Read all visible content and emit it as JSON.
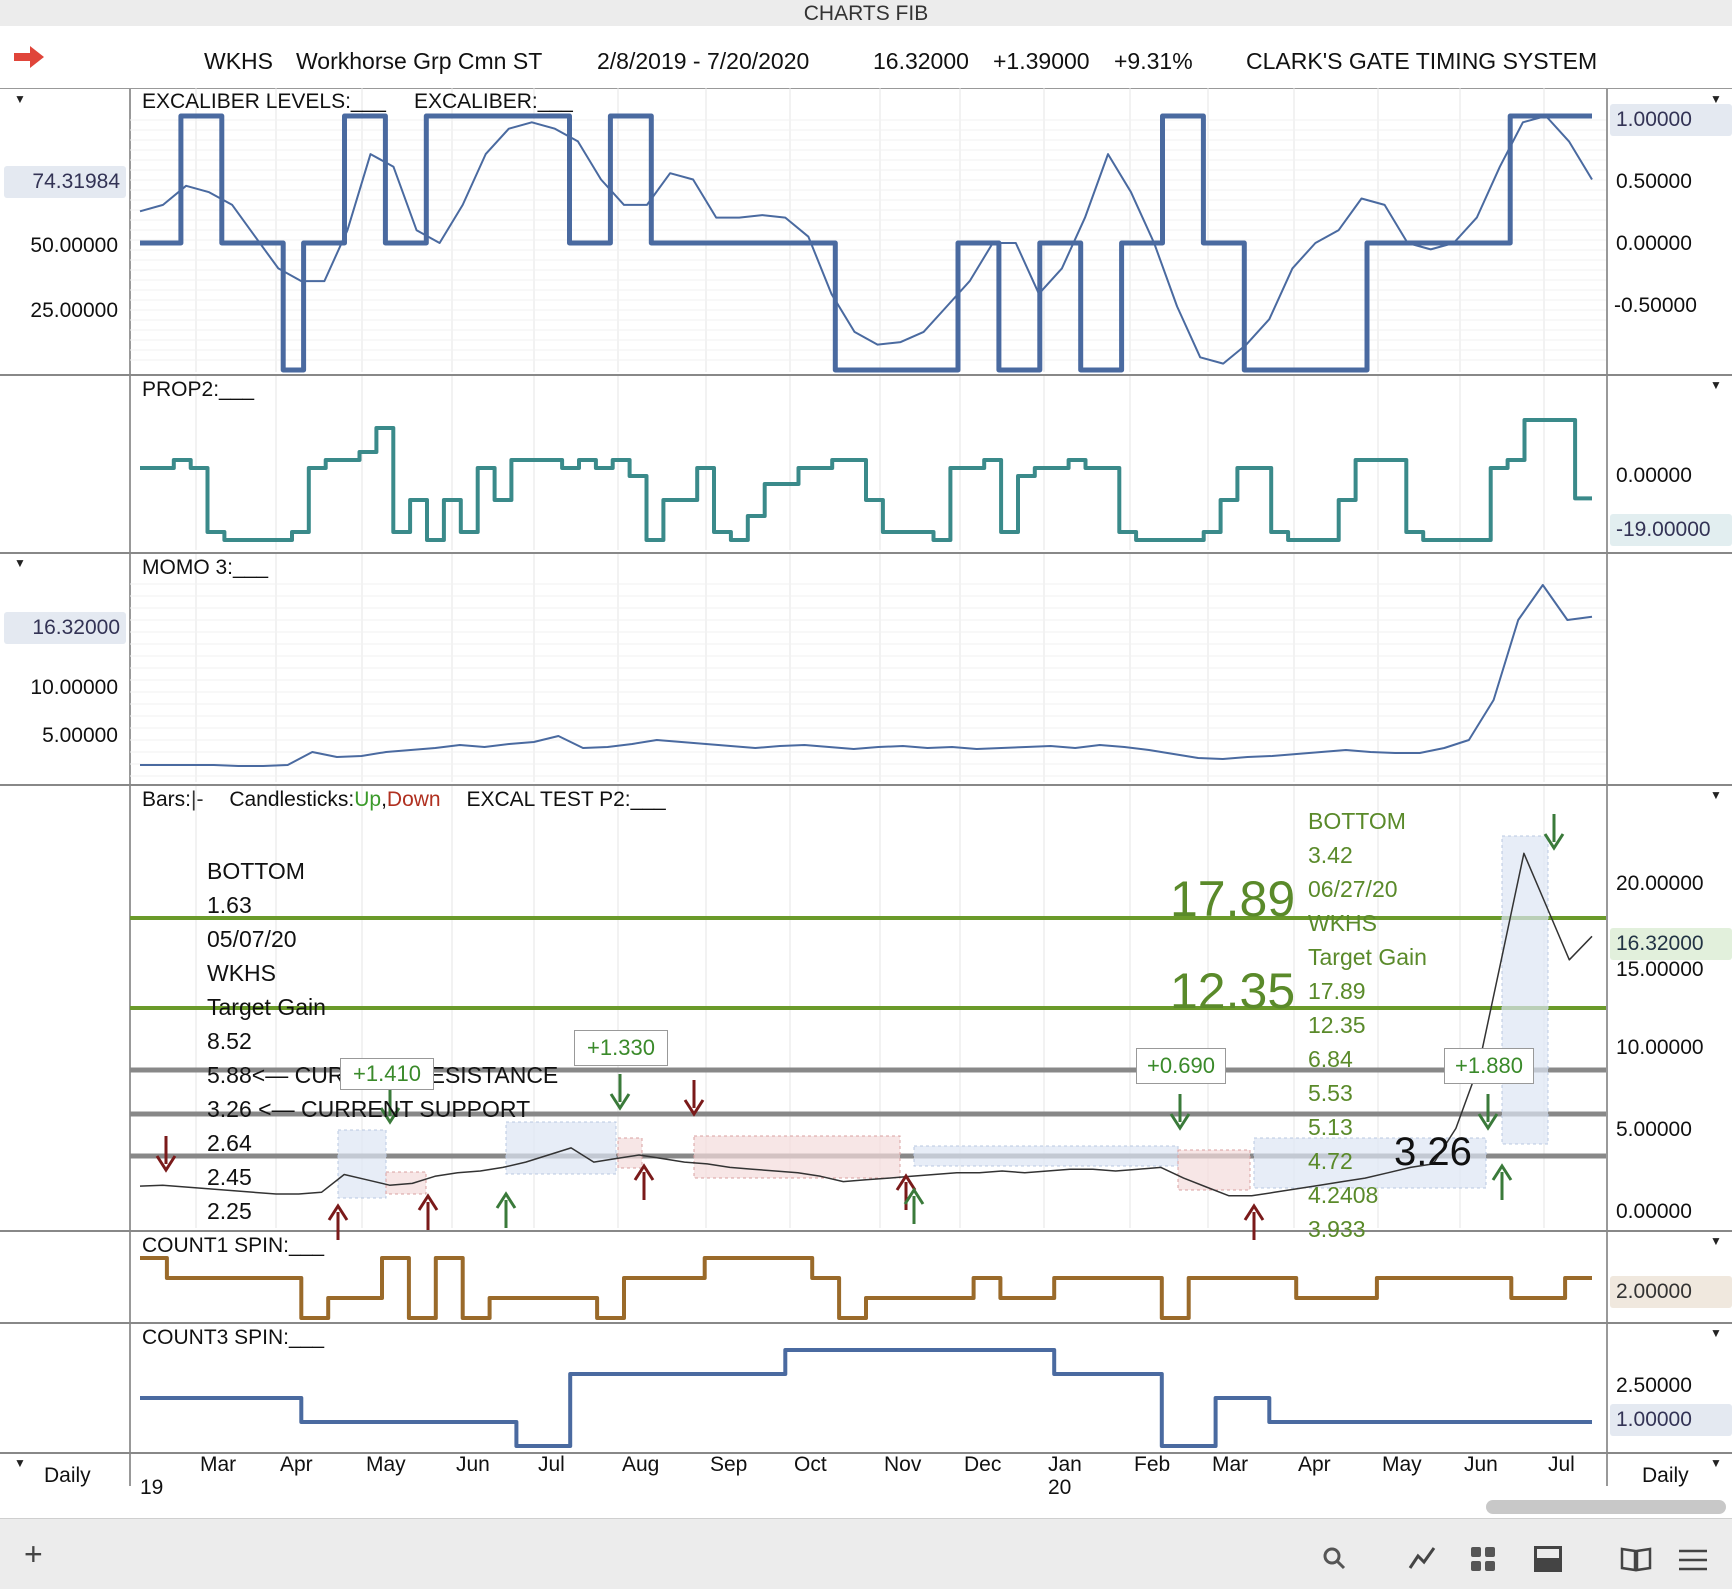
{
  "window_title": "CHARTS FIB",
  "header": {
    "symbol": "WKHS",
    "name": "Workhorse Grp Cmn ST",
    "date_range": "2/8/2019 - 7/20/2020",
    "last": "16.32000",
    "change": "+1.39000",
    "change_pct": "+9.31%",
    "system": "CLARK'S GATE TIMING SYSTEM"
  },
  "panels": {
    "excaliber": {
      "label1": "EXCALIBER LEVELS:___",
      "label2": "EXCALIBER:___",
      "left_axis": [
        "50.00000",
        "25.00000"
      ],
      "left_tag": "74.31984",
      "right_axis": [
        "0.50000",
        "0.00000",
        "-0.50000"
      ],
      "right_tag": "1.00000"
    },
    "prop2": {
      "label": "PROP2:___",
      "right_axis": [
        "0.00000"
      ],
      "right_tag": "-19.00000"
    },
    "momo3": {
      "label": "MOMO 3:___",
      "left_axis": [
        "10.00000",
        "5.00000"
      ],
      "left_tag": "16.32000"
    },
    "price": {
      "label_bars": "Bars:",
      "label_bars_sym": "|-",
      "label_candles": "Candlesticks:",
      "label_up": "Up",
      "label_comma": ",",
      "label_down": "Down",
      "label_excal": "EXCAL TEST P2:___",
      "right_axis": [
        "20.00000",
        "10.00000",
        "5.00000",
        "0.00000"
      ],
      "right_tag": "16.32000",
      "right_partial": "15.00000",
      "left_annotation": [
        "BOTTOM",
        "1.63",
        "05/07/20",
        "WKHS",
        "Target Gain",
        "8.52",
        "5.88<—  CURRENT RESISTANCE",
        "3.26 <— CURRENT SUPPORT",
        "2.64",
        "2.45",
        "2.25"
      ],
      "right_annotation": [
        "BOTTOM",
        "3.42",
        "06/27/20",
        "WKHS",
        "Target Gain",
        "17.89",
        "12.35",
        "6.84",
        "5.53",
        "5.13",
        "4.72",
        "4.2408",
        "3.933"
      ],
      "big_labels": [
        "17.89",
        "12.35",
        "3.26"
      ],
      "box_labels": [
        "+1.330",
        "+0.690",
        "+1.880",
        "+1.410"
      ],
      "level_colors": {
        "green": "#6a9a2a",
        "gray": "#888888"
      }
    },
    "count1": {
      "label": "COUNT1 SPIN:___",
      "right_tag": "2.00000"
    },
    "count3": {
      "label": "COUNT3 SPIN:___",
      "right_axis": [
        "2.50000"
      ],
      "right_tag": "1.00000"
    }
  },
  "x_axis": {
    "months": [
      "Mar",
      "Apr",
      "May",
      "Jun",
      "Jul",
      "Aug",
      "Sep",
      "Oct",
      "Nov",
      "Dec",
      "Jan",
      "Feb",
      "Mar",
      "Apr",
      "May",
      "Jun",
      "Jul"
    ],
    "years": [
      "19",
      "20"
    ],
    "left_period": "Daily",
    "right_period": "Daily"
  },
  "chart_data": [
    {
      "type": "line",
      "title": "EXCALIBER LEVELS / EXCALIBER",
      "series": [
        {
          "name": "EXCALIBER LEVELS",
          "color": "#4a6aa0",
          "values": [
            0,
            0,
            1,
            1,
            0,
            0,
            0,
            -1,
            0,
            0,
            1,
            1,
            0,
            0,
            1,
            1,
            1,
            1,
            1,
            1,
            1,
            0,
            0,
            1,
            1,
            0,
            0,
            0,
            0,
            0,
            0,
            0,
            0,
            0,
            -1,
            -1,
            -1,
            -1,
            -1,
            -1,
            0,
            0,
            -1,
            -1,
            0,
            0,
            -1,
            -1,
            0,
            0,
            1,
            1,
            0,
            0,
            -1,
            -1,
            -1,
            -1,
            -1,
            -1,
            0,
            0,
            0,
            0,
            0,
            0,
            0,
            1,
            1,
            1,
            1,
            1
          ]
        },
        {
          "name": "EXCALIBER",
          "color": "#4a6aa0",
          "values": [
            0.25,
            0.3,
            0.45,
            0.4,
            0.3,
            0.05,
            -0.2,
            -0.3,
            -0.3,
            0.1,
            0.7,
            0.6,
            0.1,
            0.0,
            0.3,
            0.7,
            0.9,
            0.95,
            0.9,
            0.8,
            0.5,
            0.3,
            0.3,
            0.55,
            0.5,
            0.2,
            0.2,
            0.22,
            0.2,
            0.05,
            -0.4,
            -0.7,
            -0.8,
            -0.78,
            -0.7,
            -0.5,
            -0.3,
            0.0,
            0.0,
            -0.4,
            -0.2,
            0.2,
            0.7,
            0.4,
            0.0,
            -0.5,
            -0.9,
            -0.95,
            -0.8,
            -0.6,
            -0.2,
            0.0,
            0.1,
            0.35,
            0.3,
            0.0,
            -0.05,
            0.0,
            0.2,
            0.6,
            0.95,
            1.0,
            0.8,
            0.5
          ]
        }
      ],
      "ylim": [
        -1,
        1
      ]
    },
    {
      "type": "line",
      "title": "PROP2",
      "series": [
        {
          "name": "PROP2",
          "color": "#3a8a8a",
          "values": [
            0,
            0,
            5,
            0,
            -40,
            -45,
            -45,
            -45,
            -45,
            -40,
            0,
            5,
            5,
            10,
            25,
            -40,
            -20,
            -45,
            -20,
            -40,
            0,
            -20,
            5,
            5,
            5,
            0,
            5,
            0,
            5,
            -5,
            -45,
            -20,
            -20,
            0,
            -40,
            -45,
            -30,
            -10,
            -10,
            0,
            0,
            5,
            5,
            -20,
            -40,
            -40,
            -40,
            -45,
            0,
            0,
            5,
            -40,
            -5,
            0,
            0,
            5,
            0,
            0,
            -40,
            -45,
            -45,
            -45,
            -45,
            -40,
            -20,
            0,
            0,
            -40,
            -45,
            -45,
            -45,
            -20,
            5,
            5,
            5,
            -40,
            -45,
            -45,
            -45,
            -45,
            0,
            5,
            30,
            30,
            30,
            -19,
            -19
          ]
        }
      ],
      "ylim": [
        -50,
        40
      ]
    },
    {
      "type": "line",
      "title": "MOMO 3",
      "series": [
        {
          "name": "MOMO 3",
          "color": "#4a6aa0",
          "values": [
            1.5,
            1.5,
            1.5,
            1.5,
            1.4,
            1.4,
            1.5,
            2.8,
            2.3,
            2.4,
            2.8,
            3.0,
            3.2,
            3.5,
            3.3,
            3.6,
            3.8,
            4.4,
            3.2,
            3.3,
            3.6,
            4.0,
            3.8,
            3.6,
            3.4,
            3.2,
            3.4,
            3.5,
            3.3,
            3.1,
            3.3,
            3.4,
            3.2,
            3.3,
            3.1,
            3.2,
            3.3,
            3.4,
            3.2,
            3.5,
            3.3,
            3.0,
            2.6,
            2.2,
            2.1,
            2.3,
            2.4,
            2.6,
            2.8,
            3.0,
            2.8,
            2.7,
            2.7,
            3.2,
            4.0,
            8.0,
            16.0,
            19.5,
            16.0,
            16.32
          ]
        }
      ],
      "ylim": [
        0,
        20
      ]
    },
    {
      "type": "line",
      "title": "Bars / Candlesticks",
      "series": [
        {
          "name": "Price",
          "color": "#333333",
          "values": [
            2.25,
            2.3,
            2.2,
            2.1,
            2.0,
            1.9,
            1.8,
            1.8,
            1.9,
            2.9,
            2.6,
            2.3,
            2.4,
            2.8,
            3.0,
            3.1,
            3.3,
            3.6,
            4.0,
            4.4,
            3.6,
            3.8,
            4.0,
            3.8,
            3.6,
            3.5,
            3.3,
            3.2,
            3.1,
            3.0,
            2.8,
            2.5,
            2.6,
            2.7,
            2.8,
            2.9,
            3.0,
            3.0,
            3.1,
            3.0,
            3.1,
            3.2,
            3.2,
            3.1,
            3.2,
            3.3,
            2.7,
            2.2,
            1.7,
            1.7,
            1.9,
            2.1,
            2.3,
            2.5,
            2.7,
            3.0,
            3.3,
            3.5,
            5.5,
            9.0,
            15.0,
            21.0,
            18.0,
            15.0,
            16.32
          ]
        }
      ],
      "ylim": [
        0,
        24
      ]
    },
    {
      "type": "line",
      "title": "COUNT1 SPIN",
      "series": [
        {
          "name": "COUNT1 SPIN",
          "color": "#9a6a2a",
          "values": [
            3,
            2,
            2,
            2,
            2,
            2,
            0,
            1,
            1,
            3,
            0,
            3,
            0,
            1,
            1,
            1,
            1,
            0,
            2,
            2,
            2,
            3,
            3,
            3,
            3,
            2,
            0,
            1,
            1,
            1,
            1,
            2,
            1,
            1,
            2,
            2,
            2,
            2,
            0,
            2,
            2,
            2,
            2,
            1,
            1,
            1,
            2,
            2,
            2,
            2,
            2,
            1,
            1,
            2,
            2
          ]
        }
      ],
      "ylim": [
        0,
        3
      ]
    },
    {
      "type": "line",
      "title": "COUNT3 SPIN",
      "series": [
        {
          "name": "COUNT3 SPIN",
          "color": "#4a6aa0",
          "values": [
            2,
            2,
            2,
            1,
            1,
            1,
            1,
            0,
            3,
            3,
            3,
            3,
            4,
            4,
            4,
            4,
            4,
            3,
            3,
            0,
            2,
            1,
            1,
            1,
            1,
            1,
            1,
            1
          ]
        }
      ],
      "ylim": [
        0,
        4
      ]
    }
  ]
}
